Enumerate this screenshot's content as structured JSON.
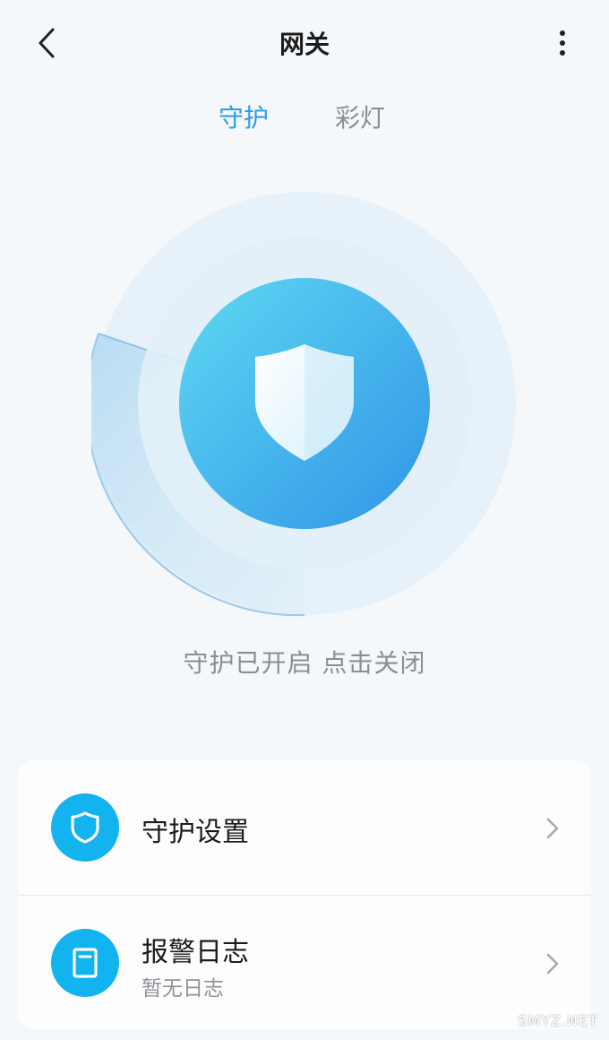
{
  "header": {
    "title": "网关",
    "back_icon": "chevron-left-icon",
    "more_icon": "more-vertical-icon"
  },
  "tabs": [
    {
      "label": "守护",
      "active": true
    },
    {
      "label": "彩灯",
      "active": false
    }
  ],
  "guard": {
    "status_text": "守护已开启 点击关闭",
    "icon": "shield-icon"
  },
  "menu": {
    "items": [
      {
        "title": "守护设置",
        "icon": "shield-outline-icon"
      },
      {
        "title": "报警日志",
        "subtitle": "暂无日志",
        "icon": "log-book-icon"
      }
    ]
  },
  "watermark": "SMYZ.NET",
  "colors": {
    "accent": "#2e9be4",
    "icon_bg": "#12b3ef",
    "background": "#f4f8fb"
  }
}
